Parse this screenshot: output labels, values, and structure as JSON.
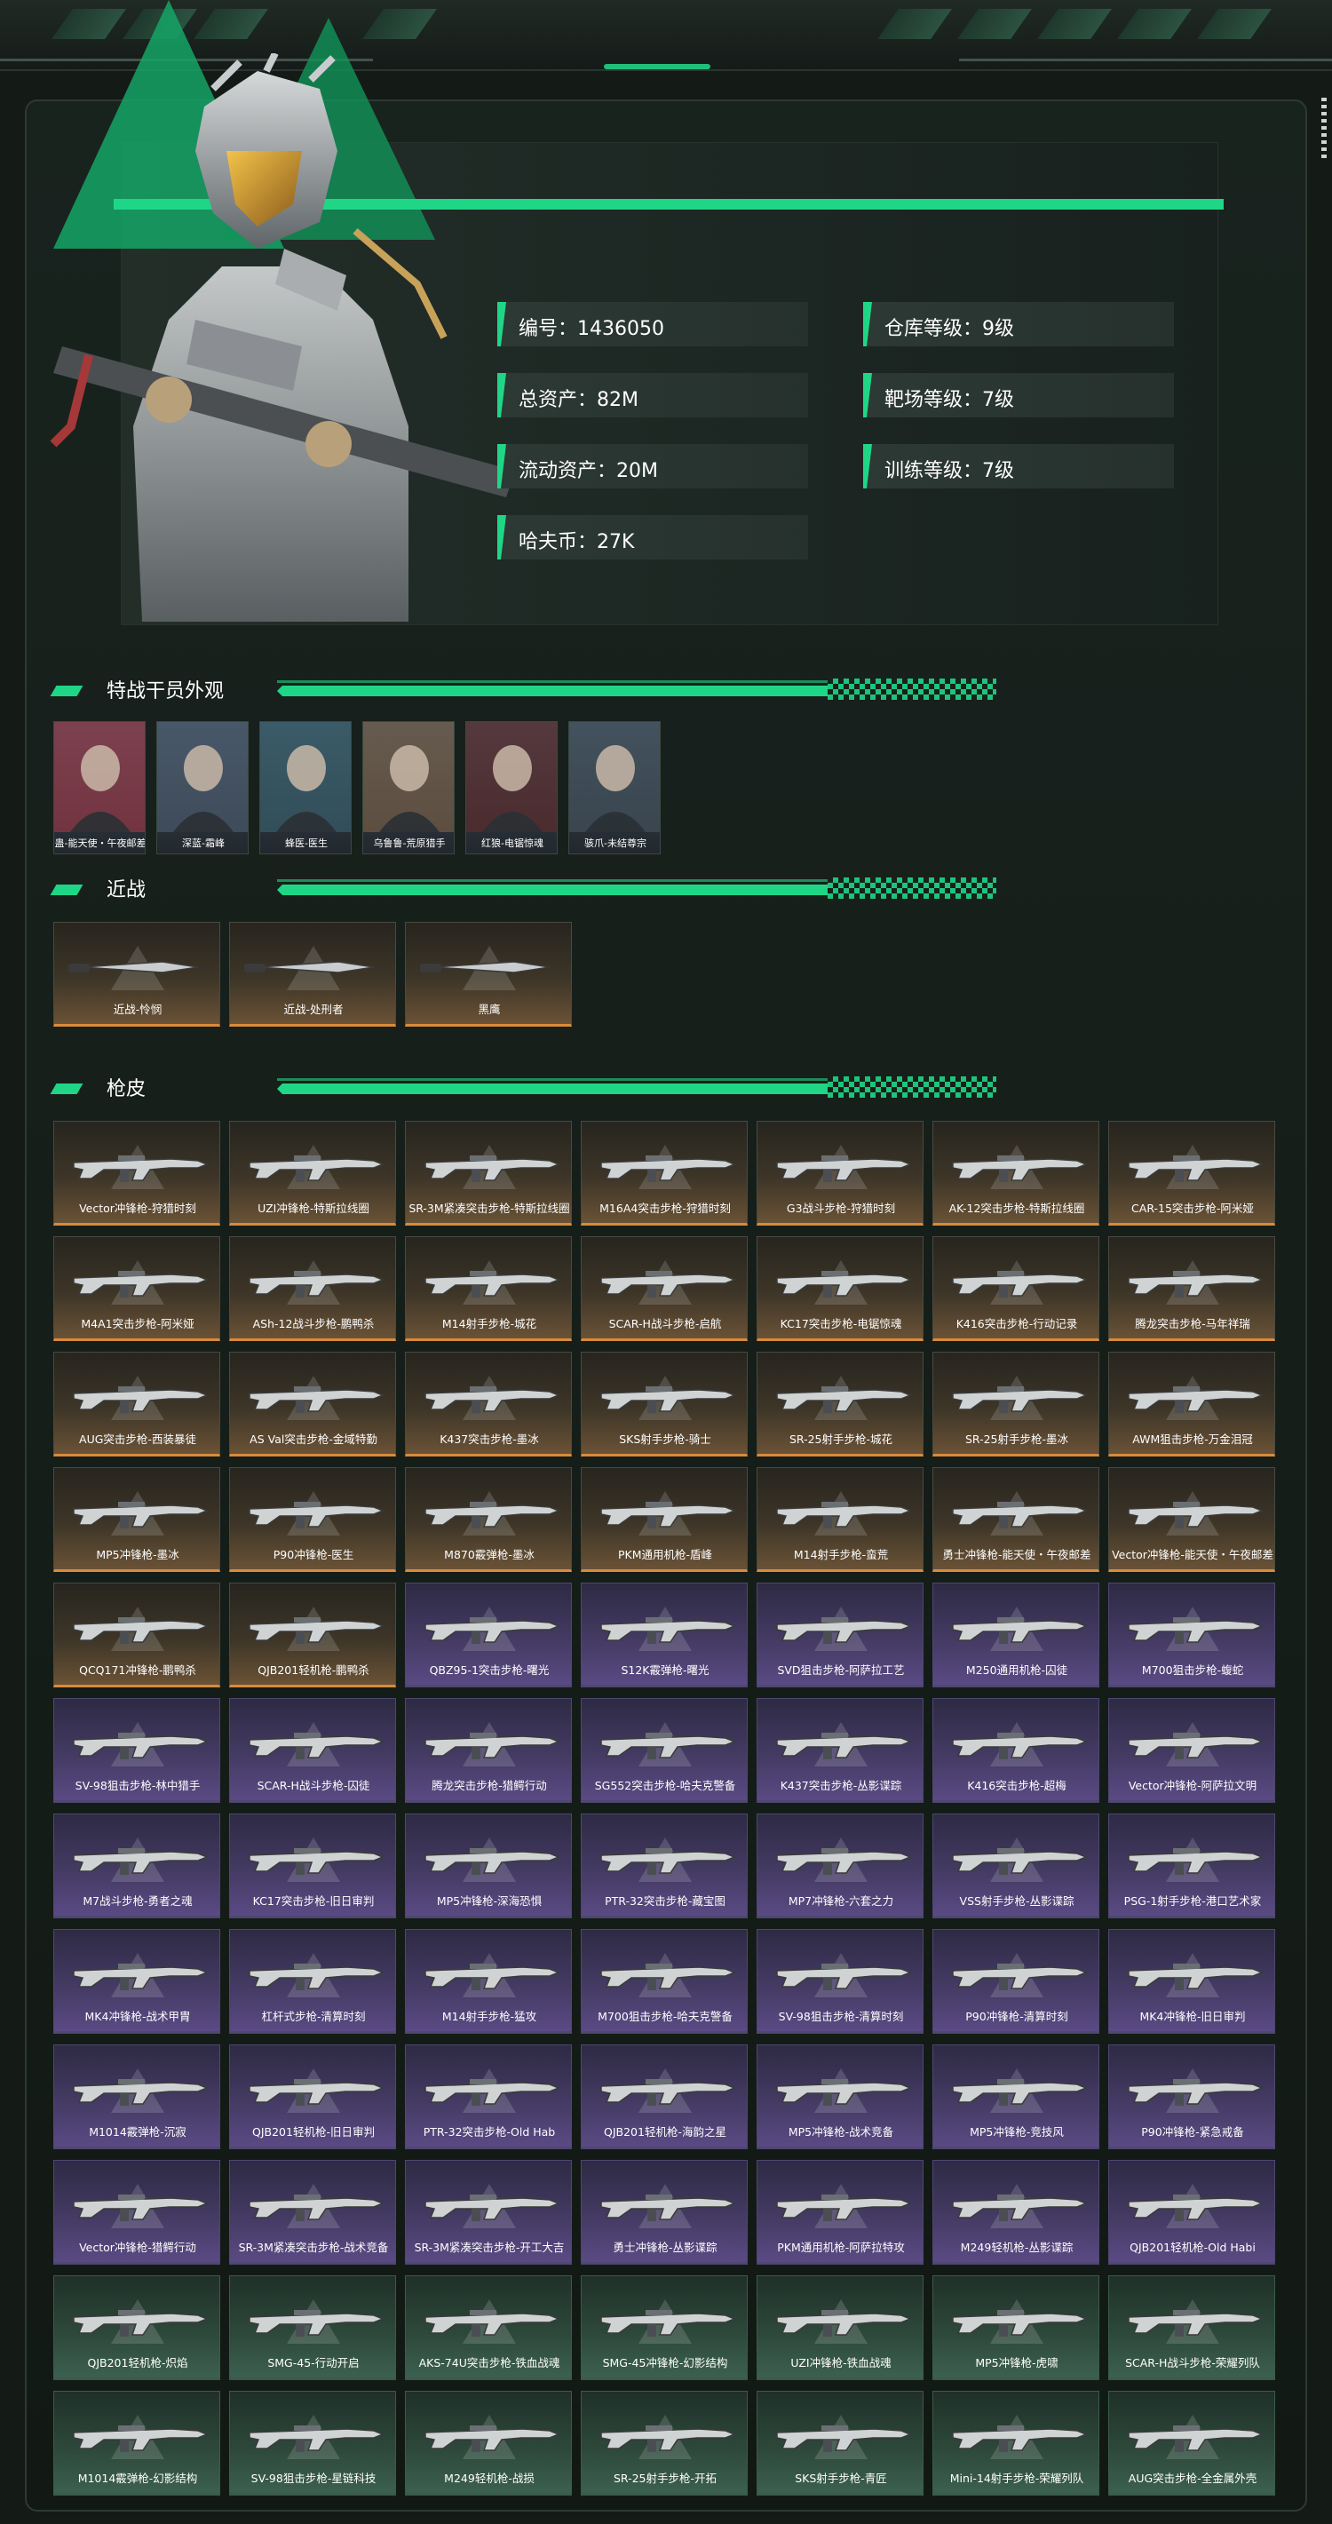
{
  "profile": {
    "stats": [
      {
        "label": "编号：1436050"
      },
      {
        "label": "仓库等级：9级"
      },
      {
        "label": "总资产：82M"
      },
      {
        "label": "靶场等级：7级"
      },
      {
        "label": "流动资产：20M"
      },
      {
        "label": "训练等级：7级"
      },
      {
        "label": "哈夫币：27K"
      }
    ]
  },
  "sections": {
    "operators_title": "特战干员外观",
    "melee_title": "近战",
    "skins_title": "枪皮"
  },
  "operators": [
    {
      "name": "蛊-能天使・午夜邮差",
      "color": "#b33a4a"
    },
    {
      "name": "深蓝-霜峰",
      "color": "#54657a"
    },
    {
      "name": "蜂医-医生",
      "color": "#3d6a78"
    },
    {
      "name": "乌鲁鲁-荒原猎手",
      "color": "#8a6a4a"
    },
    {
      "name": "红狼-电锯惊魂",
      "color": "#6a2b2b"
    },
    {
      "name": "骇爪-未结尊宗",
      "color": "#4a5a66"
    }
  ],
  "melee": [
    {
      "name": "近战-怜悯"
    },
    {
      "name": "近战-处刑者"
    },
    {
      "name": "黑鹰"
    }
  ],
  "skins": [
    {
      "name": "Vector冲锋枪-狩猎时刻",
      "tier": "gold"
    },
    {
      "name": "UZI冲锋枪-特斯拉线圈",
      "tier": "gold"
    },
    {
      "name": "SR-3M紧凑突击步枪-特斯拉线圈",
      "tier": "gold"
    },
    {
      "name": "M16A4突击步枪-狩猎时刻",
      "tier": "gold"
    },
    {
      "name": "G3战斗步枪-狩猎时刻",
      "tier": "gold"
    },
    {
      "name": "AK-12突击步枪-特斯拉线圈",
      "tier": "gold"
    },
    {
      "name": "CAR-15突击步枪-阿米娅",
      "tier": "gold"
    },
    {
      "name": "M4A1突击步枪-阿米娅",
      "tier": "gold"
    },
    {
      "name": "ASh-12战斗步枪-鹏鸭杀",
      "tier": "gold"
    },
    {
      "name": "M14射手步枪-城花",
      "tier": "gold"
    },
    {
      "name": "SCAR-H战斗步枪-启航",
      "tier": "gold"
    },
    {
      "name": "KC17突击步枪-电锯惊魂",
      "tier": "gold"
    },
    {
      "name": "K416突击步枪-行动记录",
      "tier": "gold"
    },
    {
      "name": "腾龙突击步枪-马年祥瑞",
      "tier": "gold"
    },
    {
      "name": "AUG突击步枪-西装暴徒",
      "tier": "gold"
    },
    {
      "name": "AS Val突击步枪-金域特勤",
      "tier": "gold"
    },
    {
      "name": "K437突击步枪-墨冰",
      "tier": "gold"
    },
    {
      "name": "SKS射手步枪-骑士",
      "tier": "gold"
    },
    {
      "name": "SR-25射手步枪-城花",
      "tier": "gold"
    },
    {
      "name": "SR-25射手步枪-墨冰",
      "tier": "gold"
    },
    {
      "name": "AWM狙击步枪-万金泪冠",
      "tier": "gold"
    },
    {
      "name": "MP5冲锋枪-墨冰",
      "tier": "gold"
    },
    {
      "name": "P90冲锋枪-医生",
      "tier": "gold"
    },
    {
      "name": "M870霰弹枪-墨冰",
      "tier": "gold"
    },
    {
      "name": "PKM通用机枪-盾峰",
      "tier": "gold"
    },
    {
      "name": "M14射手步枪-蛮荒",
      "tier": "gold"
    },
    {
      "name": "勇士冲锋枪-能天使・午夜邮差",
      "tier": "gold"
    },
    {
      "name": "Vector冲锋枪-能天使・午夜邮差",
      "tier": "gold"
    },
    {
      "name": "QCQ171冲锋枪-鹏鸭杀",
      "tier": "gold"
    },
    {
      "name": "QJB201轻机枪-鹏鸭杀",
      "tier": "gold"
    },
    {
      "name": "QBZ95-1突击步枪-曙光",
      "tier": "purple"
    },
    {
      "name": "S12K霰弹枪-曙光",
      "tier": "purple"
    },
    {
      "name": "SVD狙击步枪-阿萨拉工艺",
      "tier": "purple"
    },
    {
      "name": "M250通用机枪-囚徒",
      "tier": "purple"
    },
    {
      "name": "M700狙击步枪-蝮蛇",
      "tier": "purple"
    },
    {
      "name": "SV-98狙击步枪-林中猎手",
      "tier": "purple"
    },
    {
      "name": "SCAR-H战斗步枪-囚徒",
      "tier": "purple"
    },
    {
      "name": "腾龙突击步枪-猎鳄行动",
      "tier": "purple"
    },
    {
      "name": "SG552突击步枪-哈夫克警备",
      "tier": "purple"
    },
    {
      "name": "K437突击步枪-丛影谍踪",
      "tier": "purple"
    },
    {
      "name": "K416突击步枪-超梅",
      "tier": "purple"
    },
    {
      "name": "Vector冲锋枪-阿萨拉文明",
      "tier": "purple"
    },
    {
      "name": "M7战斗步枪-勇者之魂",
      "tier": "purple"
    },
    {
      "name": "KC17突击步枪-旧日审判",
      "tier": "purple"
    },
    {
      "name": "MP5冲锋枪-深海恐惧",
      "tier": "purple"
    },
    {
      "name": "PTR-32突击步枪-藏宝图",
      "tier": "purple"
    },
    {
      "name": "MP7冲锋枪-六套之力",
      "tier": "purple"
    },
    {
      "name": "VSS射手步枪-丛影谍踪",
      "tier": "purple"
    },
    {
      "name": "PSG-1射手步枪-港口艺术家",
      "tier": "purple"
    },
    {
      "name": "MK4冲锋枪-战术甲胄",
      "tier": "purple"
    },
    {
      "name": "杠杆式步枪-清算时刻",
      "tier": "purple"
    },
    {
      "name": "M14射手步枪-猛攻",
      "tier": "purple"
    },
    {
      "name": "M700狙击步枪-哈夫克警备",
      "tier": "purple"
    },
    {
      "name": "SV-98狙击步枪-清算时刻",
      "tier": "purple"
    },
    {
      "name": "P90冲锋枪-清算时刻",
      "tier": "purple"
    },
    {
      "name": "MK4冲锋枪-旧日审判",
      "tier": "purple"
    },
    {
      "name": "M1014霰弹枪-沉寂",
      "tier": "purple"
    },
    {
      "name": "QJB201轻机枪-旧日审判",
      "tier": "purple"
    },
    {
      "name": "PTR-32突击步枪-Old Hab",
      "tier": "purple"
    },
    {
      "name": "QJB201轻机枪-海韵之星",
      "tier": "purple"
    },
    {
      "name": "MP5冲锋枪-战术竞备",
      "tier": "purple"
    },
    {
      "name": "MP5冲锋枪-竞技风",
      "tier": "purple"
    },
    {
      "name": "P90冲锋枪-紧急戒备",
      "tier": "purple"
    },
    {
      "name": "Vector冲锋枪-猎鳄行动",
      "tier": "purple"
    },
    {
      "name": "SR-3M紧凑突击步枪-战术竞备",
      "tier": "purple"
    },
    {
      "name": "SR-3M紧凑突击步枪-开工大吉",
      "tier": "purple"
    },
    {
      "name": "勇士冲锋枪-丛影谍踪",
      "tier": "purple"
    },
    {
      "name": "PKM通用机枪-阿萨拉特攻",
      "tier": "purple"
    },
    {
      "name": "M249轻机枪-丛影谍踪",
      "tier": "purple"
    },
    {
      "name": "QJB201轻机枪-Old Habi",
      "tier": "purple"
    },
    {
      "name": "QJB201轻机枪-炽焰",
      "tier": "green"
    },
    {
      "name": "SMG-45-行动开启",
      "tier": "green"
    },
    {
      "name": "AKS-74U突击步枪-铁血战魂",
      "tier": "green"
    },
    {
      "name": "SMG-45冲锋枪-幻影结构",
      "tier": "green"
    },
    {
      "name": "UZI冲锋枪-铁血战魂",
      "tier": "green"
    },
    {
      "name": "MP5冲锋枪-虎啸",
      "tier": "green"
    },
    {
      "name": "SCAR-H战斗步枪-荣耀列队",
      "tier": "green"
    },
    {
      "name": "M1014霰弹枪-幻影结构",
      "tier": "green"
    },
    {
      "name": "SV-98狙击步枪-星链科技",
      "tier": "green"
    },
    {
      "name": "M249轻机枪-战损",
      "tier": "green"
    },
    {
      "name": "SR-25射手步枪-开拓",
      "tier": "green"
    },
    {
      "name": "SKS射手步枪-青匠",
      "tier": "green"
    },
    {
      "name": "Mini-14射手步枪-荣耀列队",
      "tier": "green"
    },
    {
      "name": "AUG突击步枪-全金属外壳",
      "tier": "green"
    }
  ]
}
